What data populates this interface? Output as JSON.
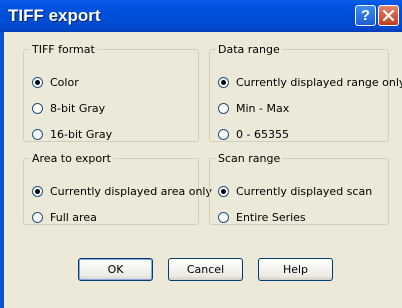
{
  "window": {
    "title": "TIFF export",
    "help_glyph": "?",
    "close_icon": "close-icon"
  },
  "tiff_format": {
    "label": "TIFF format",
    "options": [
      {
        "label": "Color",
        "selected": true
      },
      {
        "label": "8-bit Gray",
        "selected": false
      },
      {
        "label": "16-bit Gray",
        "selected": false
      }
    ]
  },
  "data_range": {
    "label": "Data range",
    "options": [
      {
        "label": "Currently displayed range only",
        "selected": true
      },
      {
        "label": "Min - Max",
        "selected": false
      },
      {
        "label": "0 - 65355",
        "selected": false
      }
    ]
  },
  "area_to_export": {
    "label": "Area to export",
    "options": [
      {
        "label": "Currently displayed area only",
        "selected": true
      },
      {
        "label": "Full area",
        "selected": false
      }
    ]
  },
  "scan_range": {
    "label": "Scan range",
    "options": [
      {
        "label": "Currently displayed scan",
        "selected": true
      },
      {
        "label": "Entire Series",
        "selected": false
      }
    ]
  },
  "buttons": {
    "ok": "OK",
    "cancel": "Cancel",
    "help": "Help"
  }
}
